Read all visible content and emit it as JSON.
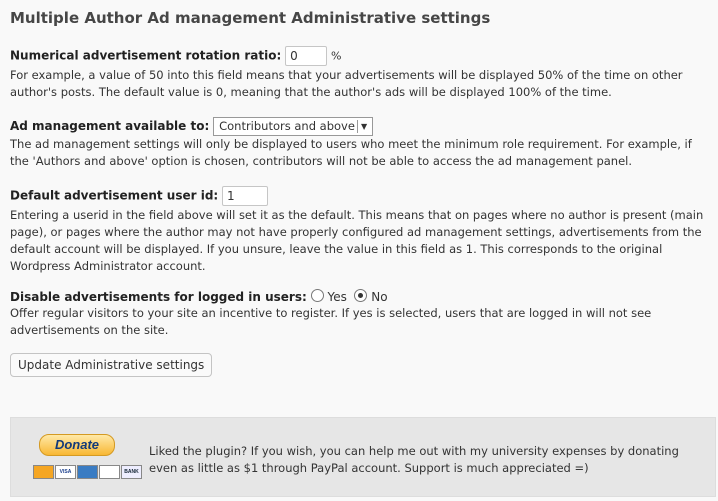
{
  "title": "Multiple Author Ad management Administrative settings",
  "rotation": {
    "label": "Numerical advertisement rotation ratio:",
    "value": "0",
    "unit": "%",
    "desc": "For example, a value of 50 into this field means that your advertisements will be displayed 50% of the time on other author's posts. The default value is 0, meaning that the author's ads will be displayed 100% of the time."
  },
  "ad_management": {
    "label": "Ad management available to:",
    "selected": "Contributors and above",
    "desc": "The ad management settings will only be displayed to users who meet the minimum role requirement. For example, if the 'Authors and above' option is chosen, contributors will not be able to access the ad management panel."
  },
  "default_user": {
    "label": "Default advertisement user id:",
    "value": "1",
    "desc": "Entering a userid in the field above will set it as the default. This means that on pages where no author is present (main page), or pages where the author may not have properly configured ad management settings, advertisements from the default account will be displayed. If you unsure, leave the value in this field as 1. This corresponds to the original Wordpress Administrator account."
  },
  "disable_logged": {
    "label": "Disable advertisements for logged in users:",
    "yes_label": "Yes",
    "no_label": "No",
    "selected": "No",
    "desc": "Offer regular visitors to your site an incentive to register. If yes is selected, users that are logged in will not see advertisements on the site."
  },
  "update_button": "Update Administrative settings",
  "donate": {
    "button_label": "Donate",
    "cards": [
      "MasterCard",
      "VISA",
      "AMEX",
      "DISCOVER",
      "BANK"
    ],
    "text": "Liked the plugin? If you wish, you can help me out with my university expenses by donating even as little as $1 through PayPal account. Support is much appreciated =)"
  }
}
